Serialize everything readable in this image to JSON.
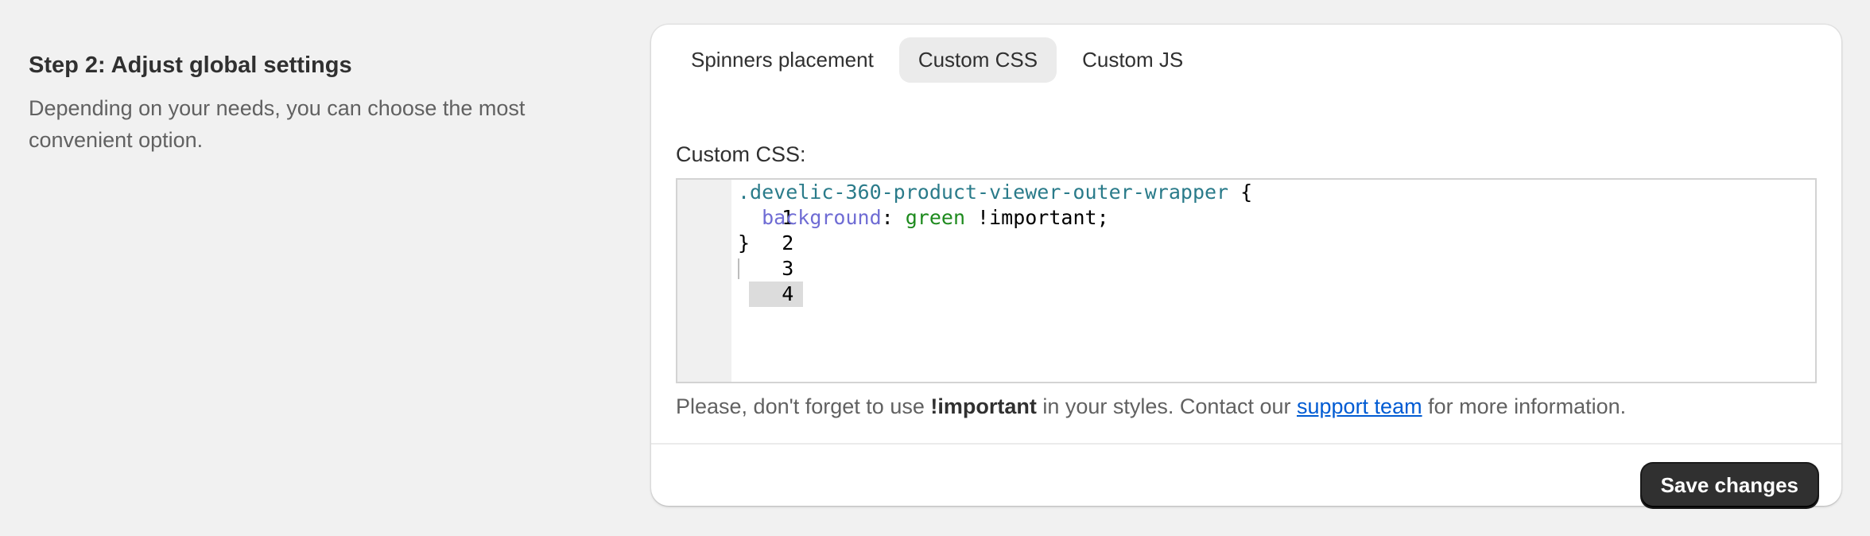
{
  "section": {
    "title": "Step 2: Adjust global settings",
    "description": "Depending on your needs, you can choose the most convenient option."
  },
  "tabs": [
    {
      "label": "Spinners placement",
      "active": false
    },
    {
      "label": "Custom CSS",
      "active": true
    },
    {
      "label": "Custom JS",
      "active": false
    }
  ],
  "editor": {
    "label": "Custom CSS:",
    "lines": [
      {
        "num": "1",
        "selector": ".develic-360-product-viewer-outer-wrapper",
        "brace_open": " {"
      },
      {
        "num": "2",
        "indent": "  ",
        "property": "background",
        "colon": ": ",
        "value": "green",
        "rest": " !important;"
      },
      {
        "num": "3",
        "brace_close": "}"
      },
      {
        "num": "4"
      }
    ],
    "active_line": 4
  },
  "help": {
    "prefix": "Please, don't forget to use ",
    "bold": "!important",
    "middle": " in your styles. Contact our ",
    "link": "support team",
    "suffix": " for more information."
  },
  "footer": {
    "save_label": "Save changes"
  },
  "colors": {
    "background": "#f1f1f1",
    "card": "#ffffff",
    "primary_button": "#303030",
    "link": "#005bd3",
    "active_tab": "#ebebeb"
  }
}
